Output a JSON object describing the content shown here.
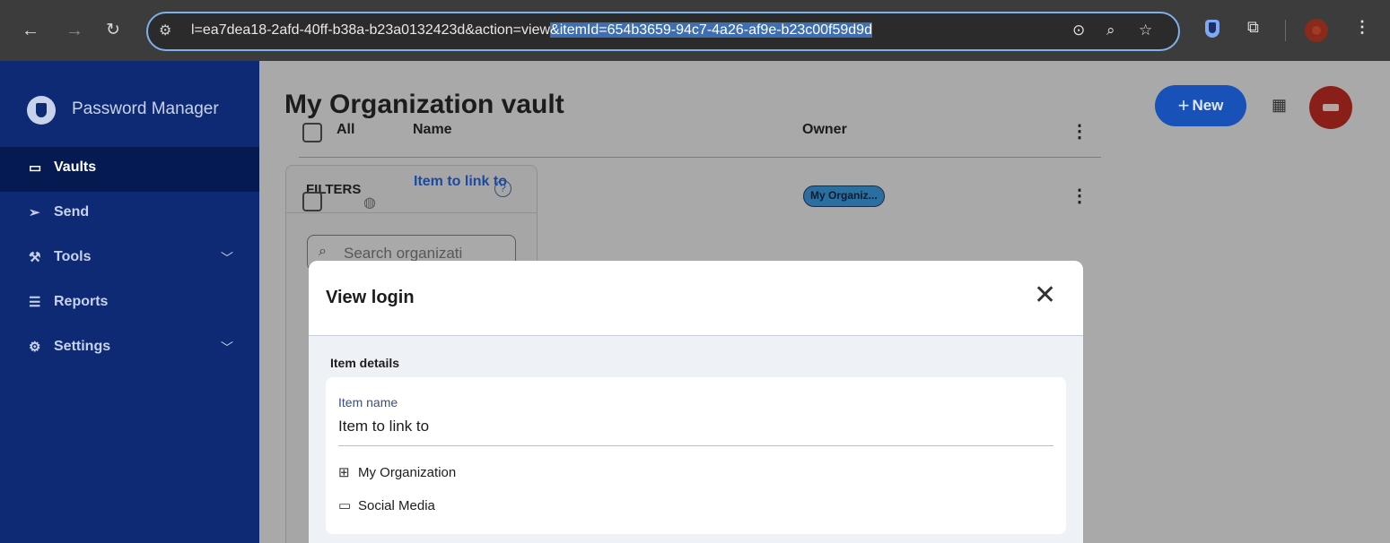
{
  "browser": {
    "url_prefix": "l=ea7dea18-2afd-40ff-b38a-b23a0132423d&action=view",
    "url_selected": "&itemId=654b3659-94c7-4a26-af9e-b23c00f59d9d"
  },
  "sidebar": {
    "brand": "Password Manager",
    "items": [
      {
        "label": "Vaults",
        "icon": "vault-icon"
      },
      {
        "label": "Send",
        "icon": "send-icon"
      },
      {
        "label": "Tools",
        "icon": "tools-icon"
      },
      {
        "label": "Reports",
        "icon": "reports-icon"
      },
      {
        "label": "Settings",
        "icon": "gear-icon"
      }
    ]
  },
  "main": {
    "title": "My Organization vault",
    "new_button": "New",
    "filters": {
      "title": "FILTERS",
      "search_placeholder": "Search organizati"
    },
    "table": {
      "col_all": "All",
      "col_name": "Name",
      "col_owner": "Owner",
      "rows": [
        {
          "name": "Item to link to",
          "owner": "My Organiz..."
        }
      ]
    }
  },
  "dialog": {
    "title": "View login",
    "section": "Item details",
    "field_label": "Item name",
    "field_value": "Item to link to",
    "organization": "My Organization",
    "collection": "Social Media"
  },
  "colors": {
    "sidebar": "#0e2a75",
    "accent": "#1852b8",
    "focus_ring": "#7fb0ea"
  }
}
